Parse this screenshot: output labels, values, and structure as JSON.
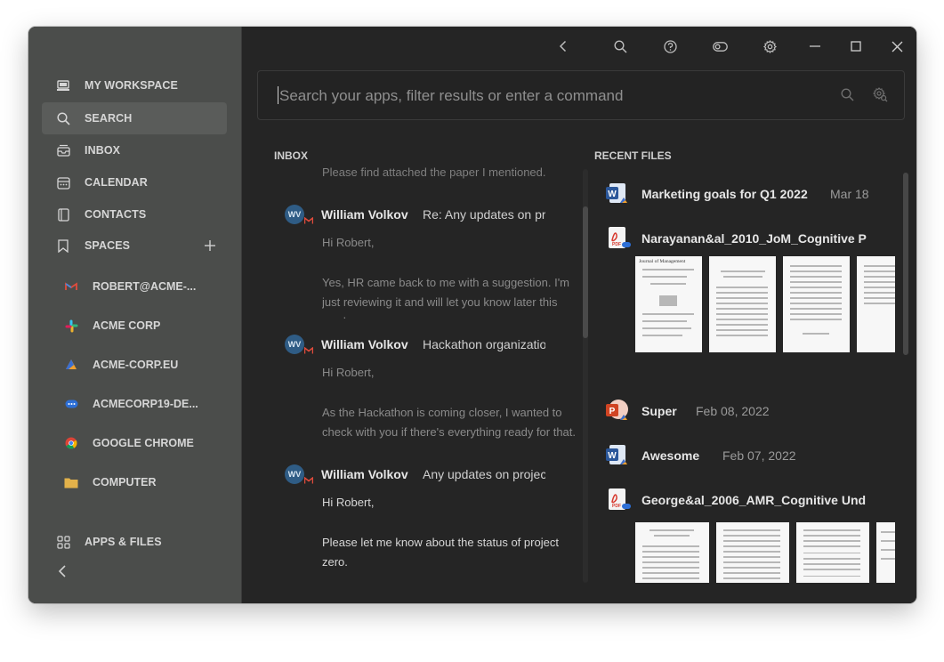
{
  "sidebar": {
    "nav": [
      {
        "label": "MY WORKSPACE",
        "icon": "workspace-icon"
      },
      {
        "label": "SEARCH",
        "icon": "search-icon",
        "active": true
      },
      {
        "label": "INBOX",
        "icon": "inbox-icon"
      },
      {
        "label": "CALENDAR",
        "icon": "calendar-icon"
      },
      {
        "label": "CONTACTS",
        "icon": "contacts-icon"
      },
      {
        "label": "SPACES",
        "icon": "bookmark-icon"
      }
    ],
    "spaces": [
      {
        "label": "ROBERT@ACME-...",
        "icon": "gmail-icon"
      },
      {
        "label": "ACME CORP",
        "icon": "slack-icon"
      },
      {
        "label": "ACME-CORP.EU",
        "icon": "cloud-drive-icon"
      },
      {
        "label": "ACMECORP19-DE...",
        "icon": "chat-icon"
      },
      {
        "label": "GOOGLE CHROME",
        "icon": "chrome-icon"
      },
      {
        "label": "COMPUTER",
        "icon": "folder-icon"
      }
    ],
    "apps_files": "APPS & FILES"
  },
  "search": {
    "placeholder": "Search your apps, filter results or enter a command"
  },
  "inbox": {
    "title": "INBOX",
    "faded_line": "Please find attached the paper I mentioned.",
    "mails": [
      {
        "avatar": "WV",
        "from": "William Volkov",
        "subject": "Re: Any updates on project zero?",
        "body": [
          "Hi Robert,",
          "Yes, HR came back to me with a suggestion. I'm just reviewing it and will let you know later this week."
        ]
      },
      {
        "avatar": "WV",
        "from": "William Volkov",
        "subject": "Hackathon organization",
        "body": [
          "Hi Robert,",
          "As the Hackathon is coming closer, I wanted to check with you if there's everything ready for that."
        ]
      },
      {
        "avatar": "WV",
        "from": "William Volkov",
        "subject": "Any updates on project zero?",
        "body": [
          "Hi Robert,",
          "Please let me know about the status of project zero."
        ]
      }
    ]
  },
  "recent_files": {
    "title": "RECENT FILES",
    "files": [
      {
        "name": "Marketing goals for Q1 2022",
        "date": "Mar 18",
        "type": "word-icon"
      },
      {
        "name": "Narayanan&al_2010_JoM_Cognitive P",
        "date": "",
        "type": "pdf-icon"
      },
      {
        "name": "Super",
        "date": "Feb 08, 2022",
        "type": "powerpoint-icon"
      },
      {
        "name": "Awesome",
        "date": "Feb 07, 2022",
        "type": "word-icon"
      },
      {
        "name": "George&al_2006_AMR_Cognitive Und",
        "date": "",
        "type": "pdf-icon"
      }
    ],
    "thumb_title": "Journal of Management"
  },
  "colors": {
    "background": "#252525",
    "sidebar": "#4b4d4b",
    "accent": "#2f5c85"
  }
}
